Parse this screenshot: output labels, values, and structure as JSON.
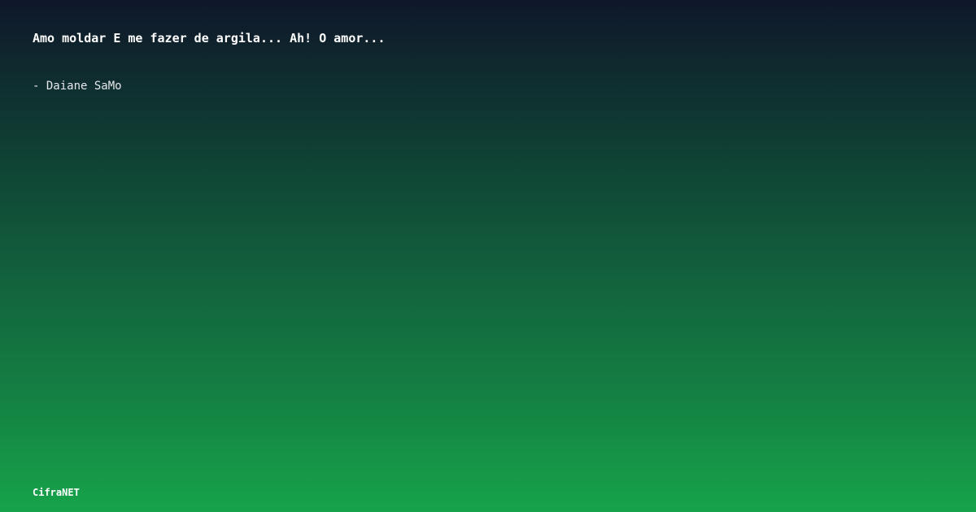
{
  "quote": {
    "text": "Amo moldar E me fazer de argila... Ah! O amor...",
    "author": "- Daiane SaMo"
  },
  "footer": {
    "brand": "CifraNET"
  },
  "colors": {
    "gradient_top": "#0f172a",
    "gradient_bottom": "#16a34a",
    "text": "#ffffff"
  }
}
